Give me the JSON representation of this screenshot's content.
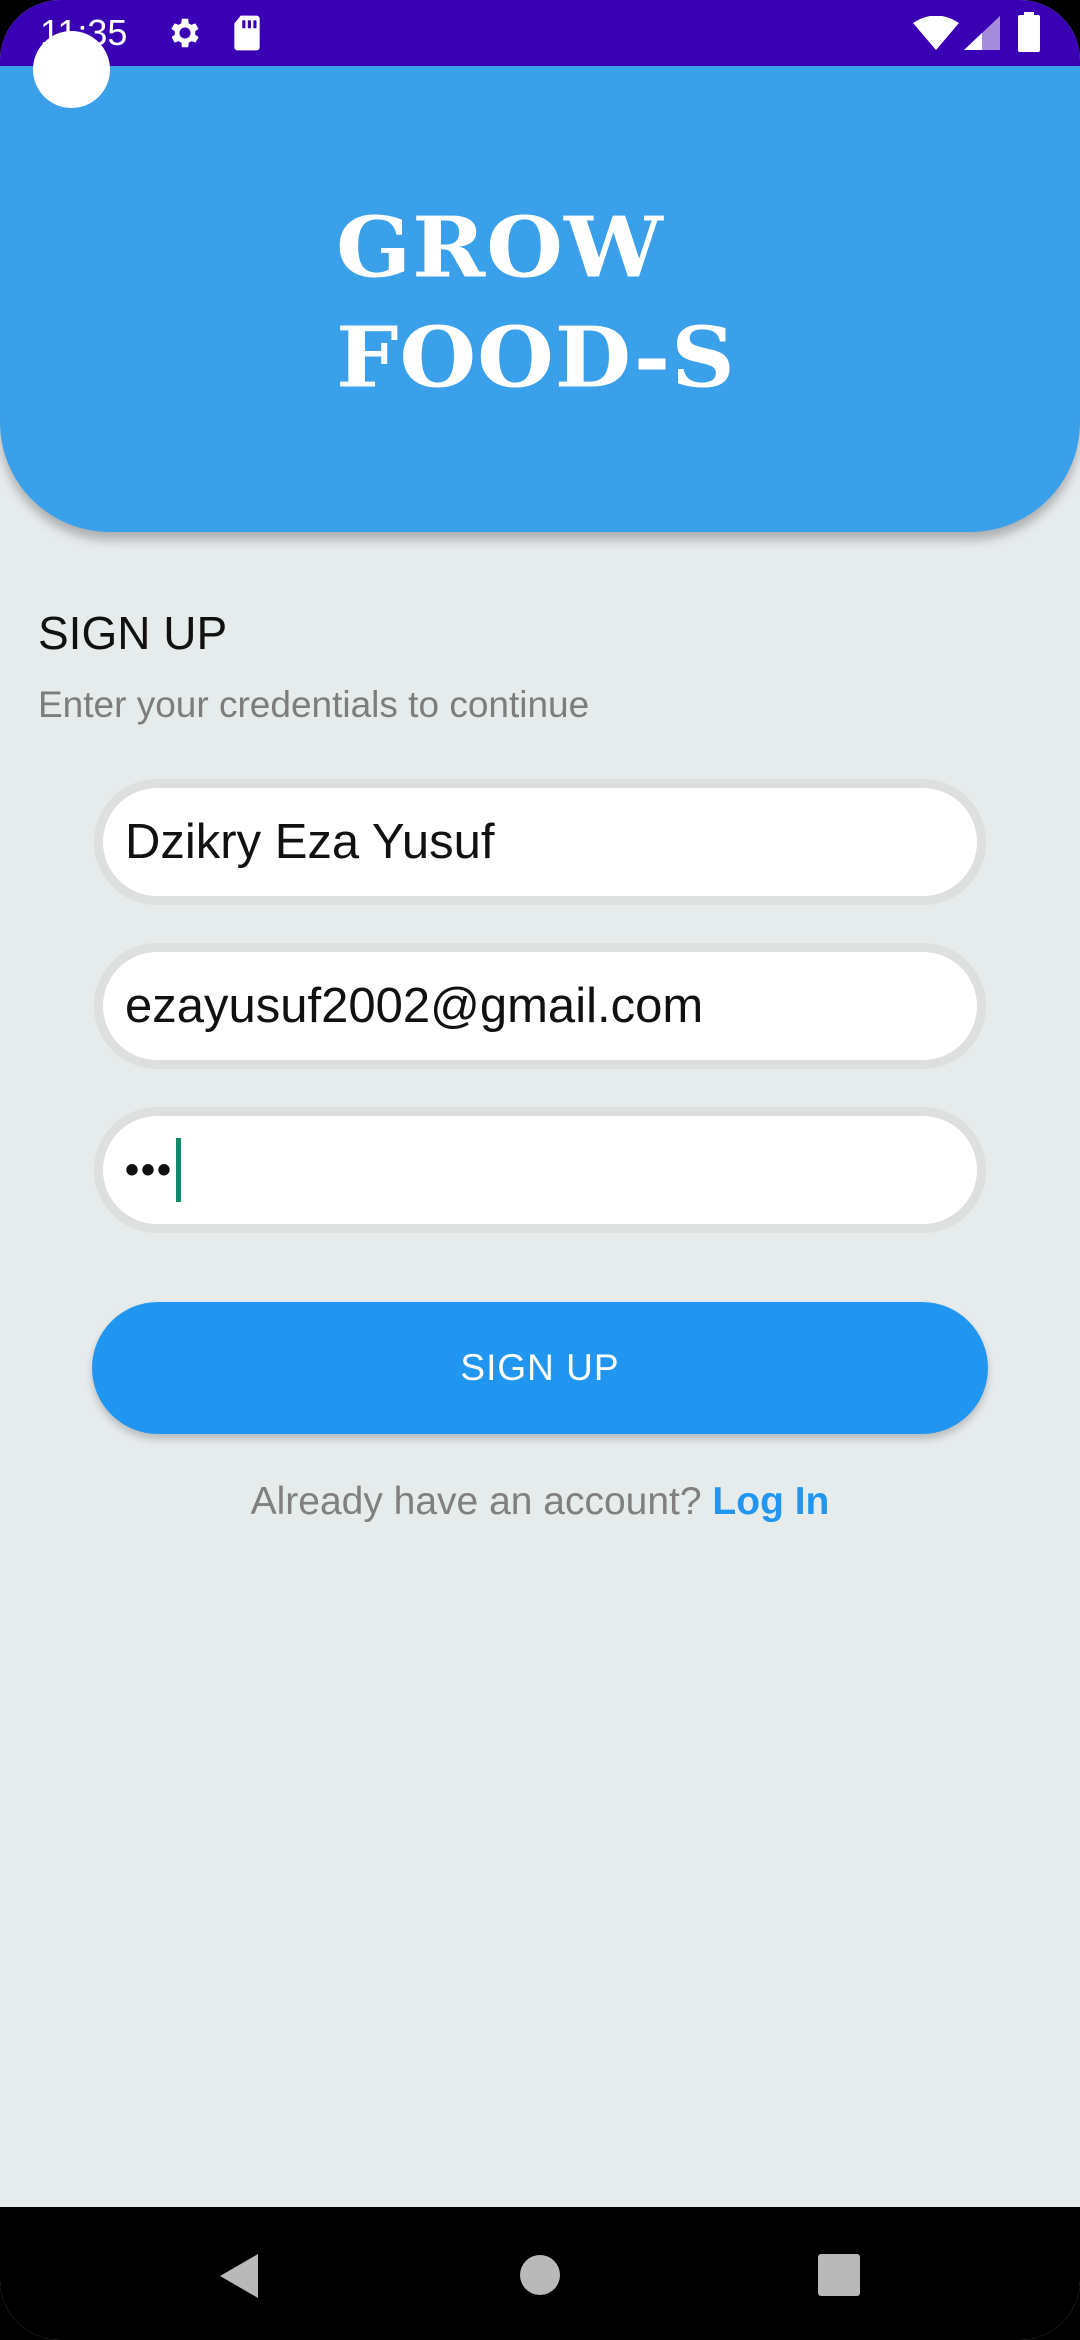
{
  "status_bar": {
    "time": "11:35",
    "icons": [
      "gear-icon",
      "sd-card-icon",
      "wifi-icon",
      "signal-icon",
      "battery-icon"
    ]
  },
  "header": {
    "logo_line1": "GROW",
    "logo_line2": "FOOD-S"
  },
  "form": {
    "title": "SIGN UP",
    "subtitle": "Enter your credentials to continue",
    "name_value": "Dzikry Eza Yusuf",
    "email_value": "ezayusuf2002@gmail.com",
    "password_value": "•••",
    "submit_label": "SIGN UP"
  },
  "footer": {
    "prompt": "Already have an account? ",
    "link": "Log In"
  },
  "nav_bar": {
    "buttons": [
      "back-icon",
      "home-icon",
      "recents-icon"
    ]
  },
  "colors": {
    "status_bar": "#3a00b3",
    "header": "#3ba0ea",
    "accent": "#2196f0",
    "background": "#e6ebec"
  }
}
